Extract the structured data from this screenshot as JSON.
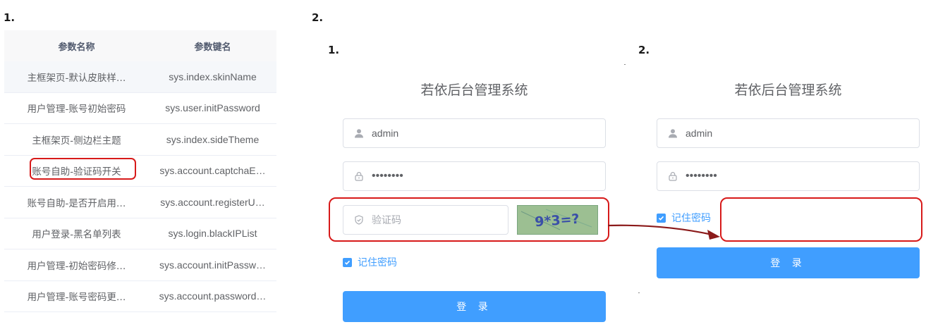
{
  "steps": {
    "left": "1.",
    "right": "2.",
    "panel1": "1.",
    "panel2": "2."
  },
  "table": {
    "headers": [
      "参数名称",
      "参数键名"
    ],
    "rows": [
      [
        "主框架页-默认皮肤样…",
        "sys.index.skinName"
      ],
      [
        "用户管理-账号初始密码",
        "sys.user.initPassword"
      ],
      [
        "主框架页-侧边栏主题",
        "sys.index.sideTheme"
      ],
      [
        "账号自助-验证码开关",
        "sys.account.captchaE…"
      ],
      [
        "账号自助-是否开启用…",
        "sys.account.registerU…"
      ],
      [
        "用户登录-黑名单列表",
        "sys.login.blackIPList"
      ],
      [
        "用户管理-初始密码修…",
        "sys.account.initPassw…"
      ],
      [
        "用户管理-账号密码更…",
        "sys.account.password…"
      ]
    ]
  },
  "login1": {
    "title": "若依后台管理系统",
    "username": "admin",
    "password": "••••••••",
    "captcha_placeholder": "验证码",
    "captcha_text": "9*3=?",
    "remember": "记住密码",
    "submit": "登 录"
  },
  "login2": {
    "title": "若依后台管理系统",
    "username": "admin",
    "password": "••••••••",
    "remember": "记住密码",
    "submit": "登 录"
  },
  "colors": {
    "accent": "#409eff",
    "highlight": "#d71a1a",
    "arrow": "#8b1a1a",
    "captcha_bg": "#9cbf92"
  },
  "icons": [
    "user-icon",
    "lock-icon",
    "shield-icon",
    "check-icon",
    "arrow-icon"
  ]
}
